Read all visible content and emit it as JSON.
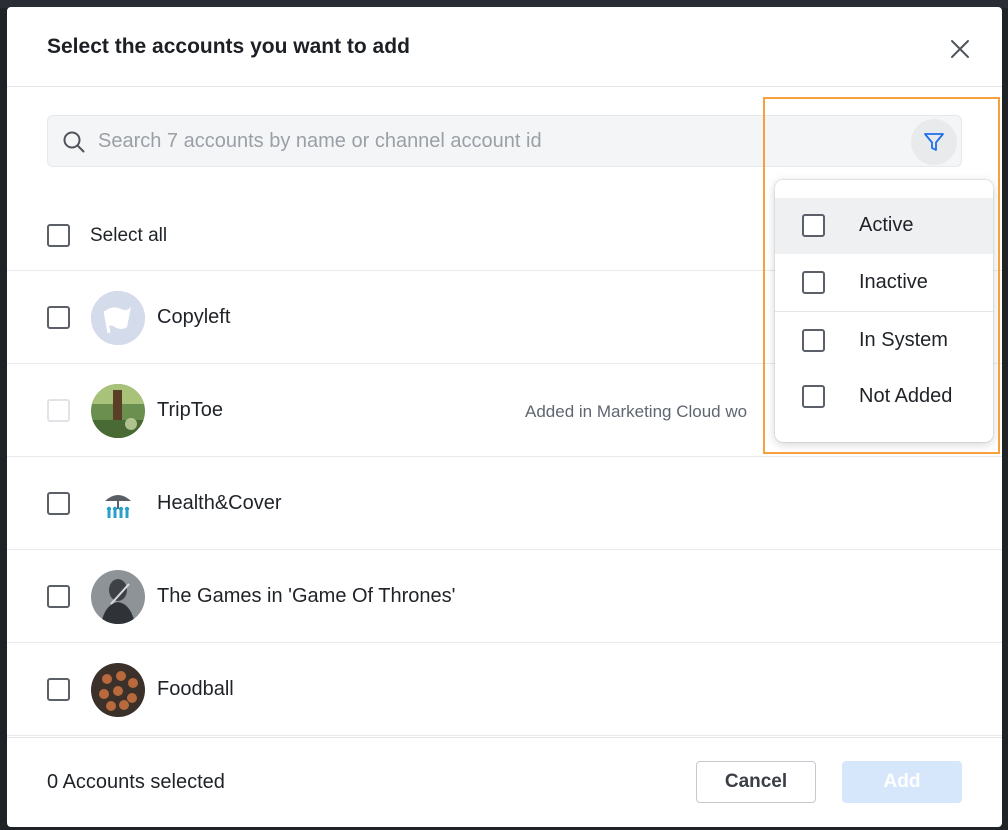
{
  "modal": {
    "title": "Select the accounts you want to add",
    "search_placeholder": "Search 7 accounts by name or channel account id",
    "select_all_label": "Select all"
  },
  "accounts": [
    {
      "name": "Copyleft",
      "note": "",
      "disabled": false
    },
    {
      "name": "TripToe",
      "note": "Added in Marketing Cloud wo",
      "disabled": true
    },
    {
      "name": "Health&Cover",
      "note": "",
      "disabled": false
    },
    {
      "name": "The Games in 'Game Of Thrones'",
      "note": "",
      "disabled": false
    },
    {
      "name": "Foodball",
      "note": "",
      "disabled": false
    }
  ],
  "filter": {
    "options": [
      "Active",
      "Inactive",
      "In System",
      "Not Added"
    ],
    "hovered": "Active"
  },
  "footer": {
    "selected_count": "0 Accounts selected",
    "cancel_label": "Cancel",
    "add_label": "Add"
  },
  "colors": {
    "accent": "#1f6feb",
    "highlight": "#f5a23c",
    "add_disabled_bg": "#d6e7fb"
  }
}
